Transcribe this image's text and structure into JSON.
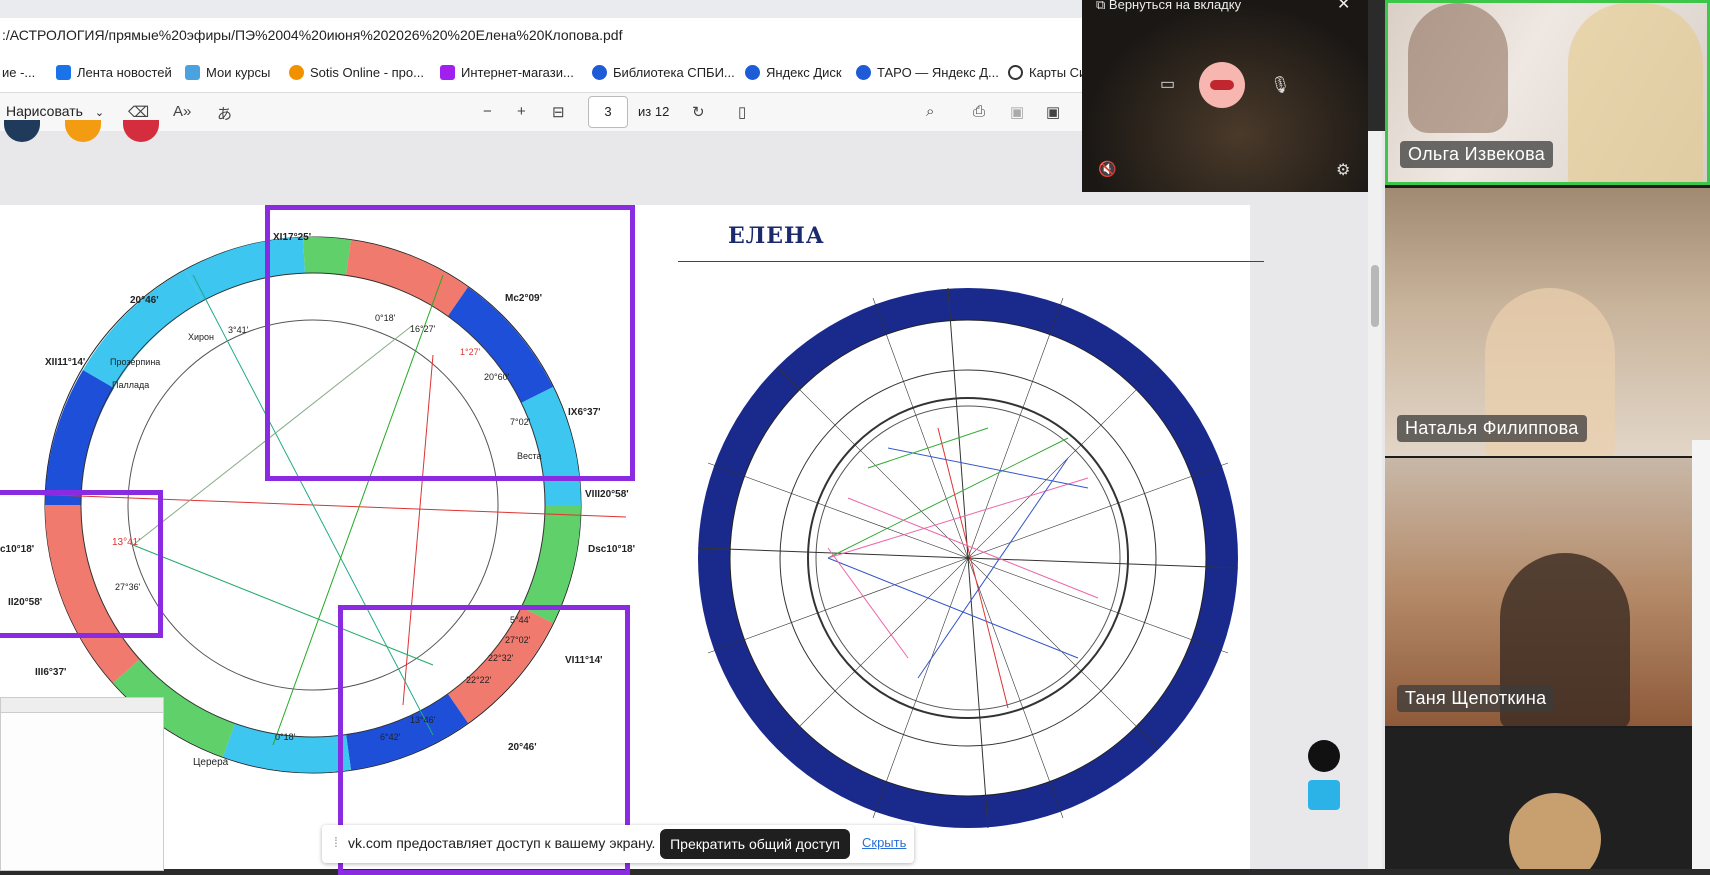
{
  "browser": {
    "url": ":/АСТРОЛОГИЯ/прямые%20эфиры/ПЭ%2004%20июня%202026%20%20Елена%20Клопова.pdf",
    "bookmarks": [
      {
        "label": "ие -...",
        "color": "#888888"
      },
      {
        "label": "Лента новостей",
        "color": "#1a73e8"
      },
      {
        "label": "Мои курсы",
        "color": "#4aa3df"
      },
      {
        "label": "Sotis Online - про...",
        "color": "#f29100"
      },
      {
        "label": "Интернет-магази...",
        "color": "#a020f0"
      },
      {
        "label": "Библиотека СПБИ...",
        "color": "#1e5bd6"
      },
      {
        "label": "Яндекс Диск",
        "color": "#1e5bd6"
      },
      {
        "label": "ТАРО — Яндекс Д...",
        "color": "#1e5bd6"
      },
      {
        "label": "Карты Си",
        "color": "#333333"
      }
    ]
  },
  "pdf_toolbar": {
    "draw_label": "Нарисовать",
    "page_current": "3",
    "page_total": "из 12"
  },
  "document": {
    "title": "ЕЛЕНА",
    "left_chart_labels": [
      "XI17°25'",
      "20°46'",
      "XII11°14'",
      "Прозерпина",
      "Паллада",
      "Хирон",
      "3°41'",
      "0°18'",
      "16°27'",
      "Mc2°09'",
      "1°27'",
      "20°60'",
      "7°02'",
      "Веста",
      "IX6°37'",
      "VIII20°58'",
      "Dsc10°18'",
      "c10°18'",
      "13°41'",
      "27°36'",
      "II20°58'",
      "Церера",
      "III6°37'",
      "5°44'",
      "27°02'",
      "22°32'",
      "22°22'",
      "VI11°14'",
      "20°46'",
      "13°46'",
      "6°42'",
      "0°18'"
    ]
  },
  "call": {
    "return_label": "Вернуться на вкладку",
    "participants": [
      {
        "name": "Ольга Извекова"
      },
      {
        "name": "Наталья Филиппова"
      },
      {
        "name": "Таня Щепоткина"
      }
    ]
  },
  "share_bar": {
    "message": "vk.com предоставляет доступ к вашему экрану.",
    "stop_label": "Прекратить общий доступ",
    "hide_label": "Скрыть"
  },
  "colors": {
    "accent_purple": "#8a2be2",
    "wheel_navy": "#1a2a8c",
    "active_speaker_green": "#3ec64a"
  }
}
